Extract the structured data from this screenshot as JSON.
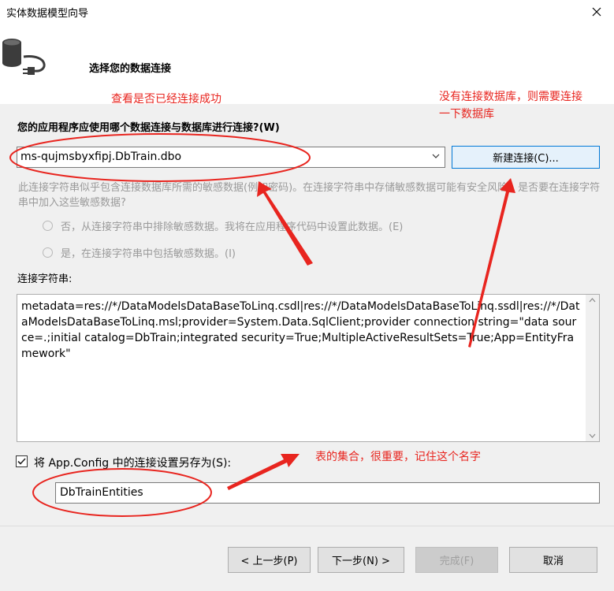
{
  "window": {
    "title": "实体数据模型向导"
  },
  "header": {
    "title": "选择您的数据连接"
  },
  "annotations": {
    "check_connection": "查看是否已经连接成功",
    "no_db_line1": "没有连接数据库，则需要连接",
    "no_db_line2": "一下数据库",
    "entity_set": "表的集合，很重要，记住这个名字"
  },
  "connection": {
    "question": "您的应用程序应使用哪个数据连接与数据库进行连接?(W)",
    "selected": "ms-qujmsbyxfipj.DbTrain.dbo",
    "new_button": "新建连接(C)...",
    "warning": "此连接字符串似乎包含连接数据库所需的敏感数据(例如密码)。在连接字符串中存储敏感数据可能有安全风险。是否要在连接字符串中加入这些敏感数据?",
    "option_exclude": "否，从连接字符串中排除敏感数据。我将在应用程序代码中设置此数据。(E)",
    "option_include": "是，在连接字符串中包括敏感数据。(I)"
  },
  "connection_string": {
    "label": "连接字符串:",
    "value": "metadata=res://*/DataModelsDataBaseToLinq.csdl|res://*/DataModelsDataBaseToLinq.ssdl|res://*/DataModelsDataBaseToLinq.msl;provider=System.Data.SqlClient;provider connection string=\"data source=.;initial catalog=DbTrain;integrated security=True;MultipleActiveResultSets=True;App=EntityFramework\""
  },
  "save_config": {
    "label": "将 App.Config 中的连接设置另存为(S):",
    "checked": true,
    "value": "DbTrainEntities"
  },
  "buttons": {
    "prev": "< 上一步(P)",
    "next": "下一步(N) >",
    "finish": "完成(F)",
    "cancel": "取消"
  },
  "colors": {
    "annotation": "#e8251f",
    "accent": "#0078d7"
  }
}
